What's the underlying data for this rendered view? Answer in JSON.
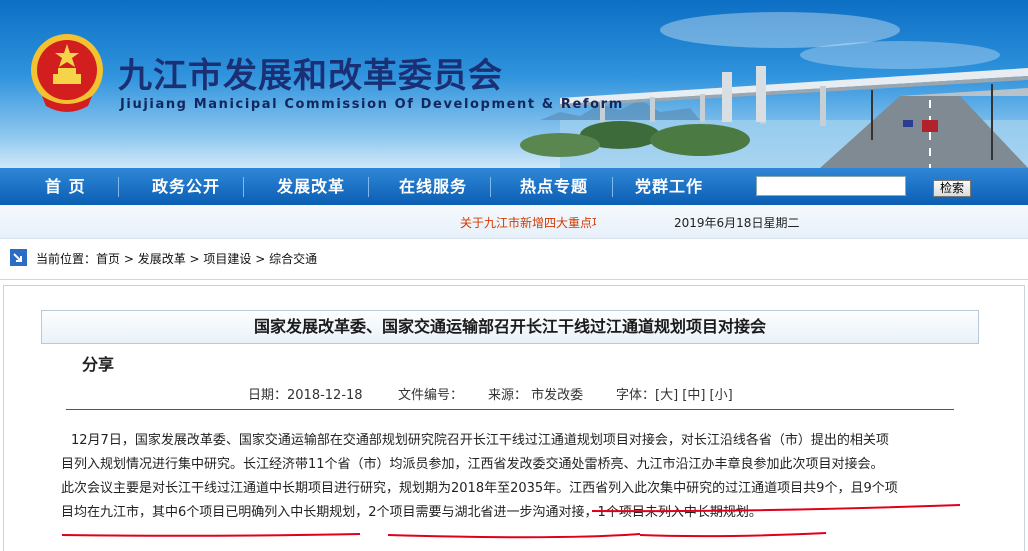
{
  "header": {
    "title_cn": "九江市发展和改革委员会",
    "title_en": "Jiujiang Manicipal Commission Of Development & Reform"
  },
  "nav": {
    "items": [
      "首 页",
      "政务公开",
      "发展改革",
      "在线服务",
      "热点专题",
      "党群工作"
    ],
    "search_placeholder": "",
    "search_button": "检索"
  },
  "ticker": {
    "text": "关于九江市新增四大重点项目的公示",
    "date": "2019年6月18日星期二"
  },
  "breadcrumb": {
    "label": "当前位置：",
    "path": "首页 > 发展改革 > 项目建设 > 综合交通"
  },
  "article": {
    "title": "国家发展改革委、国家交通运输部召开长江干线过江通道规划项目对接会",
    "share": "分享",
    "meta": {
      "date": "日期：2018-12-18",
      "file_no": "文件编号：",
      "source": "来源：  市发改委",
      "font": "字体：[大] [中] [小]"
    },
    "lines": [
      "12月7日，国家发展改革委、国家交通运输部在交通部规划研究院召开长江干线过江通道规划项目对接会，对长江沿线各省（市）提出的相关项",
      "目列入规划情况进行集中研究。长江经济带11个省（市）均派员参加，江西省发改委交通处雷桥亮、九江市沿江办丰章良参加此次项目对接会。",
      "此次会议主要是对长江干线过江通道中长期项目进行研究，规划期为2018年至2035年。江西省列入此次集中研究的过江通道项目共9个，且9个项",
      "目均在九江市，其中6个项目已明确列入中长期规划，2个项目需要与湖北省进一步沟通对接，1个项目未列入中长期规划。"
    ]
  },
  "colors": {
    "banner": "#1f82d2",
    "nav": "#0c5fb4",
    "ticker_text": "#d23a00",
    "underline": "#e0001a"
  }
}
